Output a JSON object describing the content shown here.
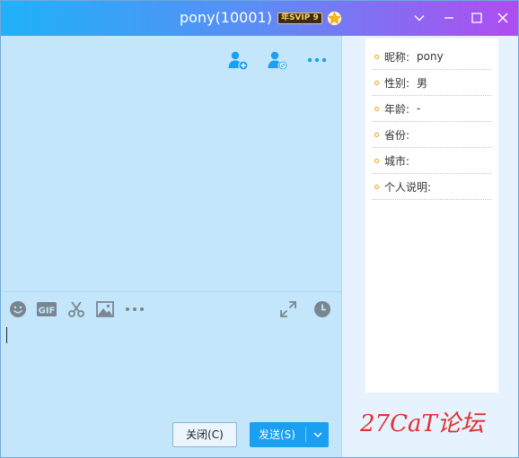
{
  "window": {
    "title": "pony(10001)",
    "vip_badge": "年SVIP 9",
    "icons": {
      "vip_star": "star-icon",
      "minimize_dropdown": "chevron-down-icon",
      "minimize": "minimize-icon",
      "maximize": "maximize-icon",
      "close": "close-icon"
    }
  },
  "chat": {
    "actions": [
      {
        "name": "add-friend-icon"
      },
      {
        "name": "block-user-icon"
      },
      {
        "name": "more-icon"
      }
    ]
  },
  "input_toolbar": {
    "tools": [
      "emoji-icon",
      "gif-icon",
      "screenshot-scissors-icon",
      "image-icon",
      "more-icon"
    ],
    "right_tools": [
      "expand-icon",
      "history-clock-icon"
    ],
    "gif_label": "GIF"
  },
  "buttons": {
    "close_label": "关闭(C)",
    "send_label": "发送(S)"
  },
  "profile": {
    "rows": [
      {
        "label": "昵称:",
        "value": "pony"
      },
      {
        "label": "性别:",
        "value": "男"
      },
      {
        "label": "年龄:",
        "value": "-"
      },
      {
        "label": "省份:",
        "value": ""
      },
      {
        "label": "城市:",
        "value": ""
      },
      {
        "label": "个人说明:",
        "value": ""
      }
    ]
  },
  "watermark": "27CaT论坛",
  "colors": {
    "titlebar_start": "#1fb2f8",
    "titlebar_end": "#b04cf0",
    "chat_bg": "#c3e6fb",
    "send_button": "#1a9ff1",
    "accent_icon": "#1a9ff1",
    "watermark": "#e03030"
  }
}
